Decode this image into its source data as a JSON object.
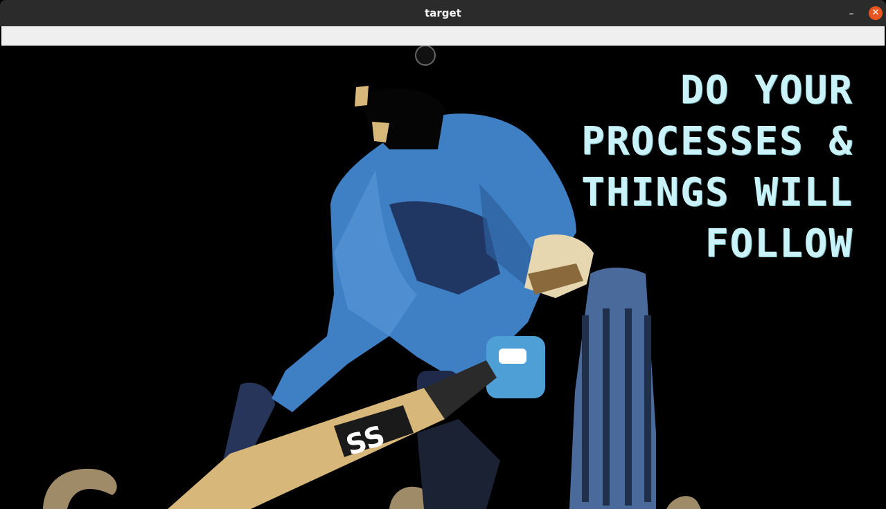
{
  "window": {
    "title": "target",
    "minimize_label": "–",
    "close_label": "✕"
  },
  "poster": {
    "quote_lines": [
      "DO YOUR",
      "PROCESSES &",
      "THINGS WILL",
      "FOLLOW"
    ],
    "bat_brand": "SS",
    "colors": {
      "background": "#000000",
      "quote": "#c9f3f8",
      "jersey": "#3f7fc4",
      "bat": "#d8b77a",
      "stumps": "#4a6a9c"
    }
  }
}
